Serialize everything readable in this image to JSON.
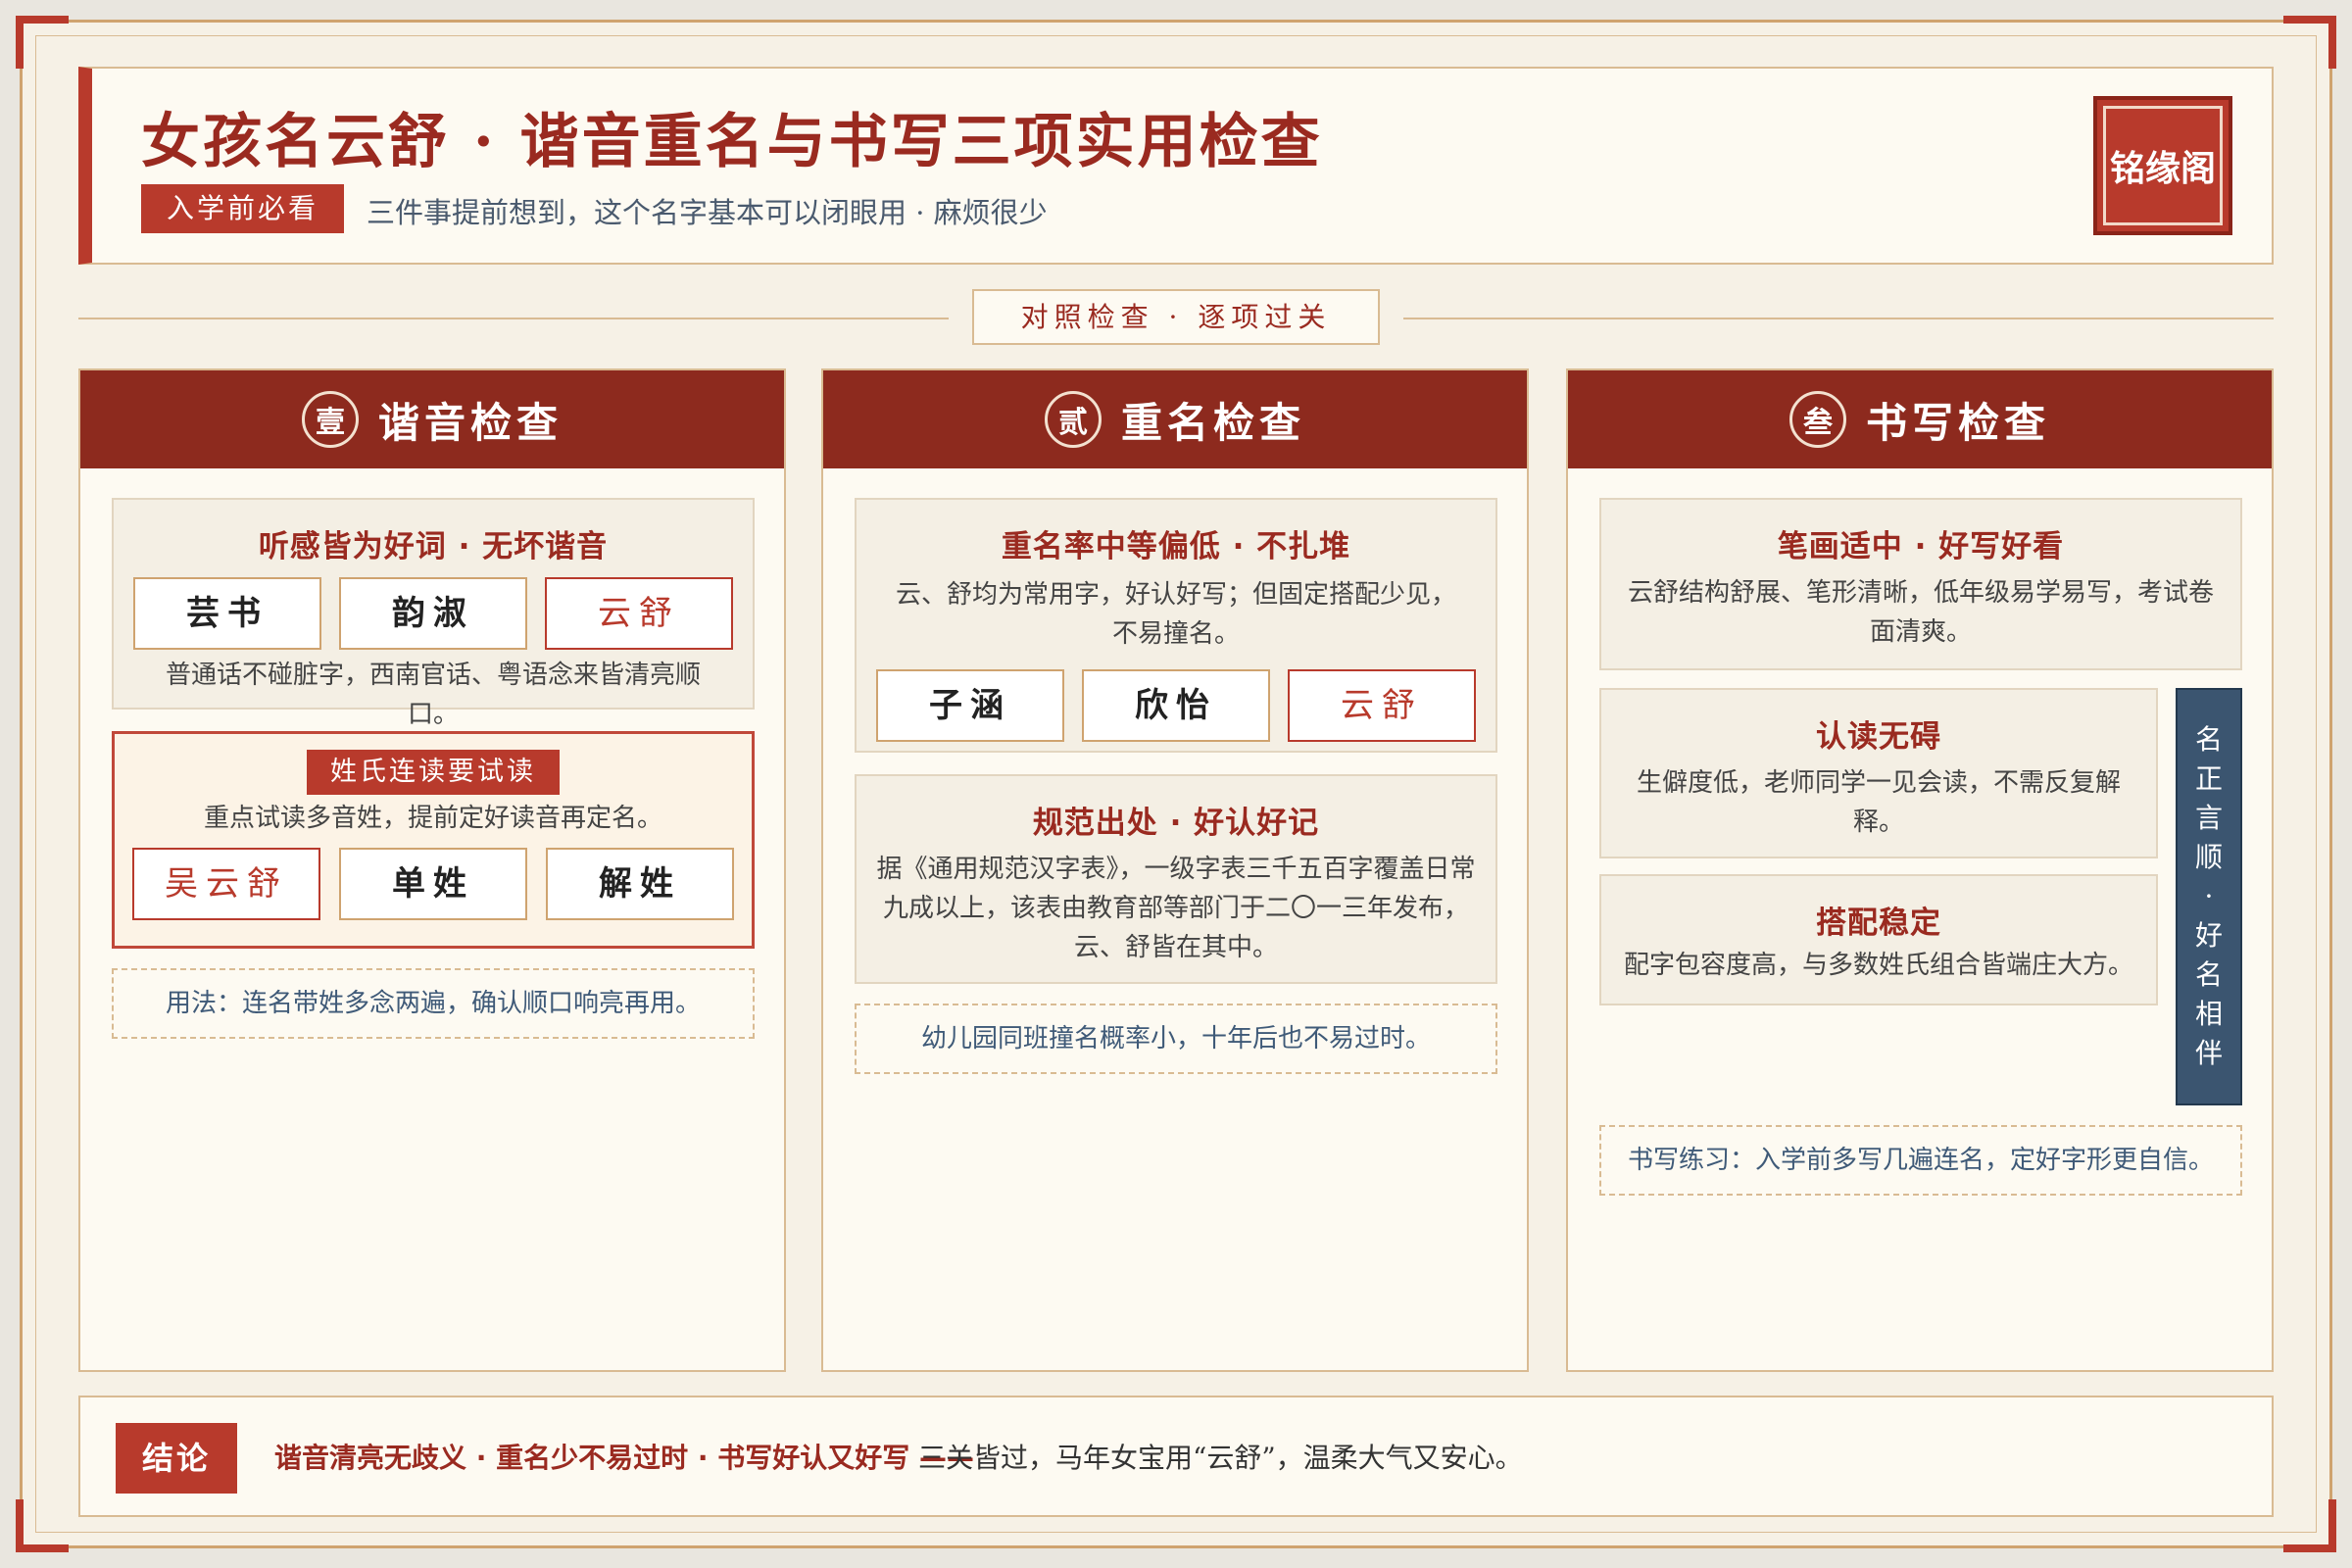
{
  "header": {
    "title": "女孩名云舒 · 谐音重名与书写三项实用检查",
    "tag": "入学前必看",
    "subtitle": "三件事提前想到，这个名字基本可以闭眼用 · 麻烦很少",
    "seal": "铭缘阁"
  },
  "divider": "对照检查 · 逐项过关",
  "columns": [
    {
      "num": "壹",
      "title": "谐音检查",
      "cards": [
        {
          "title": "听感皆为好词 · 无坏谐音",
          "chips": [
            "芸书",
            "韵淑",
            "云舒"
          ],
          "body": "普通话不碰脏字，西南官话、粤语念来皆清亮顺口。"
        }
      ],
      "alert": {
        "tag": "姓氏连读要试读",
        "body": "重点试读多音姓，提前定好读音再定名。",
        "chips": [
          "吴云舒",
          "单姓",
          "解姓"
        ]
      },
      "note": "用法：连名带姓多念两遍，确认顺口响亮再用。"
    },
    {
      "num": "贰",
      "title": "重名检查",
      "cards": [
        {
          "title": "重名率中等偏低 · 不扎堆",
          "body": "云、舒均为常用字，好认好写；但固定搭配少见，不易撞名。",
          "chips": [
            "子涵",
            "欣怡",
            "云舒"
          ]
        },
        {
          "title": "规范出处 · 好认好记",
          "body": "据《通用规范汉字表》，一级字表三千五百字覆盖日常九成以上，该表由教育部等部门于二〇一三年发布，云、舒皆在其中。"
        }
      ],
      "note": "幼儿园同班撞名概率小，十年后也不易过时。"
    },
    {
      "num": "叁",
      "title": "书写检查",
      "cards": [
        {
          "title": "笔画适中 · 好写好看",
          "body": "云舒结构舒展、笔形清晰，低年级易学易写，考试卷面清爽。"
        },
        {
          "title": "认读无碍",
          "body": "生僻度低，老师同学一见会读，不需反复解释。"
        },
        {
          "title": "搭配稳定",
          "body": "配字包容度高，与多数姓氏组合皆端庄大方。"
        }
      ],
      "side": "名正言顺 · 好名相伴",
      "note": "书写练习：入学前多写几遍连名，定好字形更自信。"
    }
  ],
  "footer": {
    "tag": "结论",
    "strong": "谐音清亮无歧义 · 重名少不易过时 · 书写好认又好写 ——",
    "text": "三关皆过，马年女宝用“云舒”，温柔大气又安心。"
  }
}
